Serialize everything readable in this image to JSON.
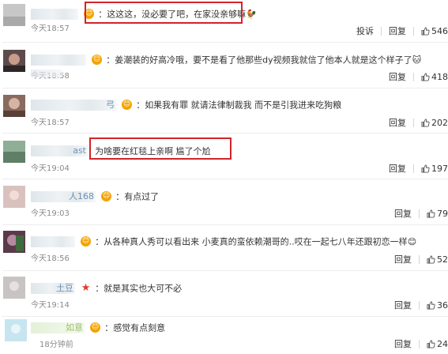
{
  "actions": {
    "report": "投诉",
    "reply": "回复"
  },
  "comments": [
    {
      "user": "",
      "badge": "😊",
      "text": "这这这，没必要了吧，在家没亲够嘛",
      "emoji": "🐓",
      "time": "今天18:57",
      "likes": "546"
    },
    {
      "user": "",
      "badge": "😊",
      "text": "姜潮装的好高冷哦，要不是看了他那些dy视频我就信了他本人就是这个样子了",
      "emoji": "🐱",
      "time": "今天18:58",
      "likes": "418"
    },
    {
      "user": "弓",
      "badge": "😊",
      "text": "如果我有罪 就请法律制裁我 而不是引我进来吃狗粮",
      "emoji": "",
      "time": "今天18:57",
      "likes": "202"
    },
    {
      "user": "ast",
      "badge": "",
      "text": "为啥要在红毯上亲啊 尴了个尬",
      "emoji": "",
      "time": "今天19:04",
      "likes": "197"
    },
    {
      "user": "人168",
      "badge": "😊",
      "text": "有点过了",
      "emoji": "",
      "time": "今天19:03",
      "likes": "79"
    },
    {
      "user": "",
      "badge": "😊",
      "text": "从各种真人秀可以看出来 小麦真的蛮依赖潮哥的..哎在一起七八年还跟初恋一样",
      "emoji": "😊",
      "time": "今天18:56",
      "likes": "52"
    },
    {
      "user": "土豆",
      "badge": "★",
      "text": "就是其实也大可不必",
      "emoji": "",
      "time": "今天19:14",
      "likes": "36"
    },
    {
      "user": "如意",
      "badge": "😊",
      "text": "感觉有点刻意",
      "emoji": "",
      "time": "18分钟前",
      "likes": "24"
    }
  ]
}
